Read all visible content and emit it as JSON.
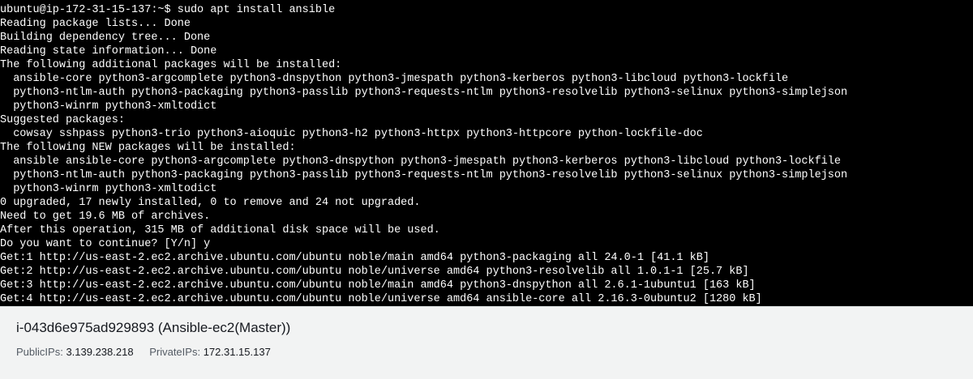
{
  "terminal": {
    "lines": [
      "ubuntu@ip-172-31-15-137:~$ sudo apt install ansible",
      "Reading package lists... Done",
      "Building dependency tree... Done",
      "Reading state information... Done",
      "The following additional packages will be installed:",
      "  ansible-core python3-argcomplete python3-dnspython python3-jmespath python3-kerberos python3-libcloud python3-lockfile",
      "  python3-ntlm-auth python3-packaging python3-passlib python3-requests-ntlm python3-resolvelib python3-selinux python3-simplejson",
      "  python3-winrm python3-xmltodict",
      "Suggested packages:",
      "  cowsay sshpass python3-trio python3-aioquic python3-h2 python3-httpx python3-httpcore python-lockfile-doc",
      "The following NEW packages will be installed:",
      "  ansible ansible-core python3-argcomplete python3-dnspython python3-jmespath python3-kerberos python3-libcloud python3-lockfile",
      "  python3-ntlm-auth python3-packaging python3-passlib python3-requests-ntlm python3-resolvelib python3-selinux python3-simplejson",
      "  python3-winrm python3-xmltodict",
      "0 upgraded, 17 newly installed, 0 to remove and 24 not upgraded.",
      "Need to get 19.6 MB of archives.",
      "After this operation, 315 MB of additional disk space will be used.",
      "Do you want to continue? [Y/n] y",
      "Get:1 http://us-east-2.ec2.archive.ubuntu.com/ubuntu noble/main amd64 python3-packaging all 24.0-1 [41.1 kB]",
      "Get:2 http://us-east-2.ec2.archive.ubuntu.com/ubuntu noble/universe amd64 python3-resolvelib all 1.0.1-1 [25.7 kB]",
      "Get:3 http://us-east-2.ec2.archive.ubuntu.com/ubuntu noble/main amd64 python3-dnspython all 2.6.1-1ubuntu1 [163 kB]",
      "Get:4 http://us-east-2.ec2.archive.ubuntu.com/ubuntu noble/universe amd64 ansible-core all 2.16.3-0ubuntu2 [1280 kB]"
    ]
  },
  "instance": {
    "title": "i-043d6e975ad929893 (Ansible-ec2(Master))",
    "public_label": "PublicIPs:",
    "public_ip": "3.139.238.218",
    "private_label": "PrivateIPs:",
    "private_ip": "172.31.15.137"
  }
}
